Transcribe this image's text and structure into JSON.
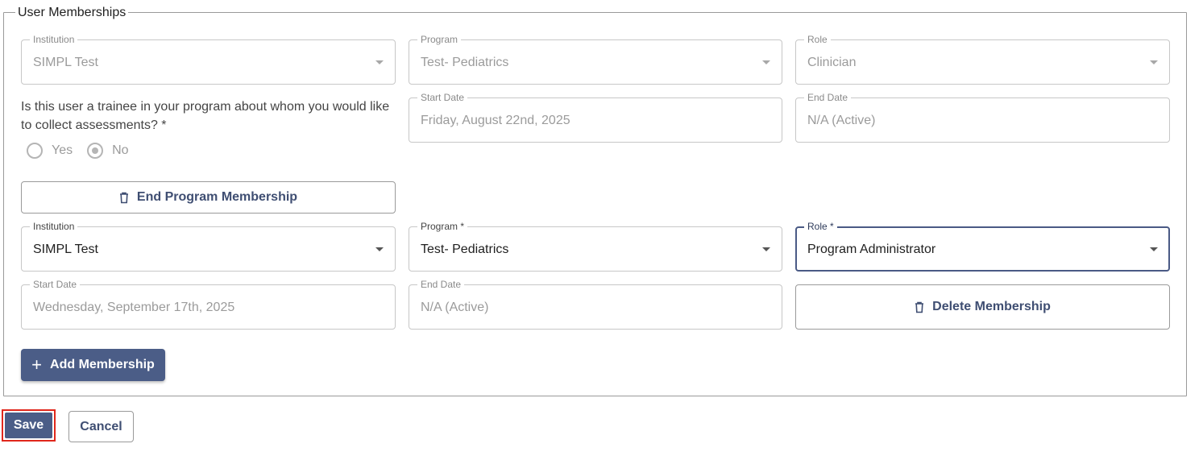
{
  "fieldset": {
    "legend": "User Memberships"
  },
  "membership1": {
    "institution": {
      "label": "Institution",
      "value": "SIMPL Test"
    },
    "program": {
      "label": "Program",
      "value": "Test- Pediatrics"
    },
    "role": {
      "label": "Role",
      "value": "Clinician"
    },
    "start_date": {
      "label": "Start Date",
      "value": "Friday, August 22nd, 2025"
    },
    "end_date": {
      "label": "End Date",
      "value": "N/A (Active)"
    },
    "trainee_question": "Is this user a trainee in your program about whom you would like to collect assessments? *",
    "radio_yes": "Yes",
    "radio_no": "No",
    "selected": "No",
    "end_button": "End Program Membership"
  },
  "membership2": {
    "institution": {
      "label": "Institution",
      "value": "SIMPL Test"
    },
    "program": {
      "label": "Program *",
      "value": "Test- Pediatrics"
    },
    "role": {
      "label": "Role *",
      "value": "Program Administrator"
    },
    "start_date": {
      "label": "Start Date",
      "value": "Wednesday, September 17th, 2025"
    },
    "end_date": {
      "label": "End Date",
      "value": "N/A (Active)"
    },
    "delete_button": "Delete Membership"
  },
  "add_button": "Add Membership",
  "actions": {
    "save": "Save",
    "cancel": "Cancel"
  },
  "icons": {
    "trash": "trash-icon",
    "plus": "plus-icon",
    "dropdown": "caret-down-icon"
  },
  "colors": {
    "primary": "#4b5d87",
    "highlight": "#e0271c",
    "text_link": "#3f4e72"
  }
}
